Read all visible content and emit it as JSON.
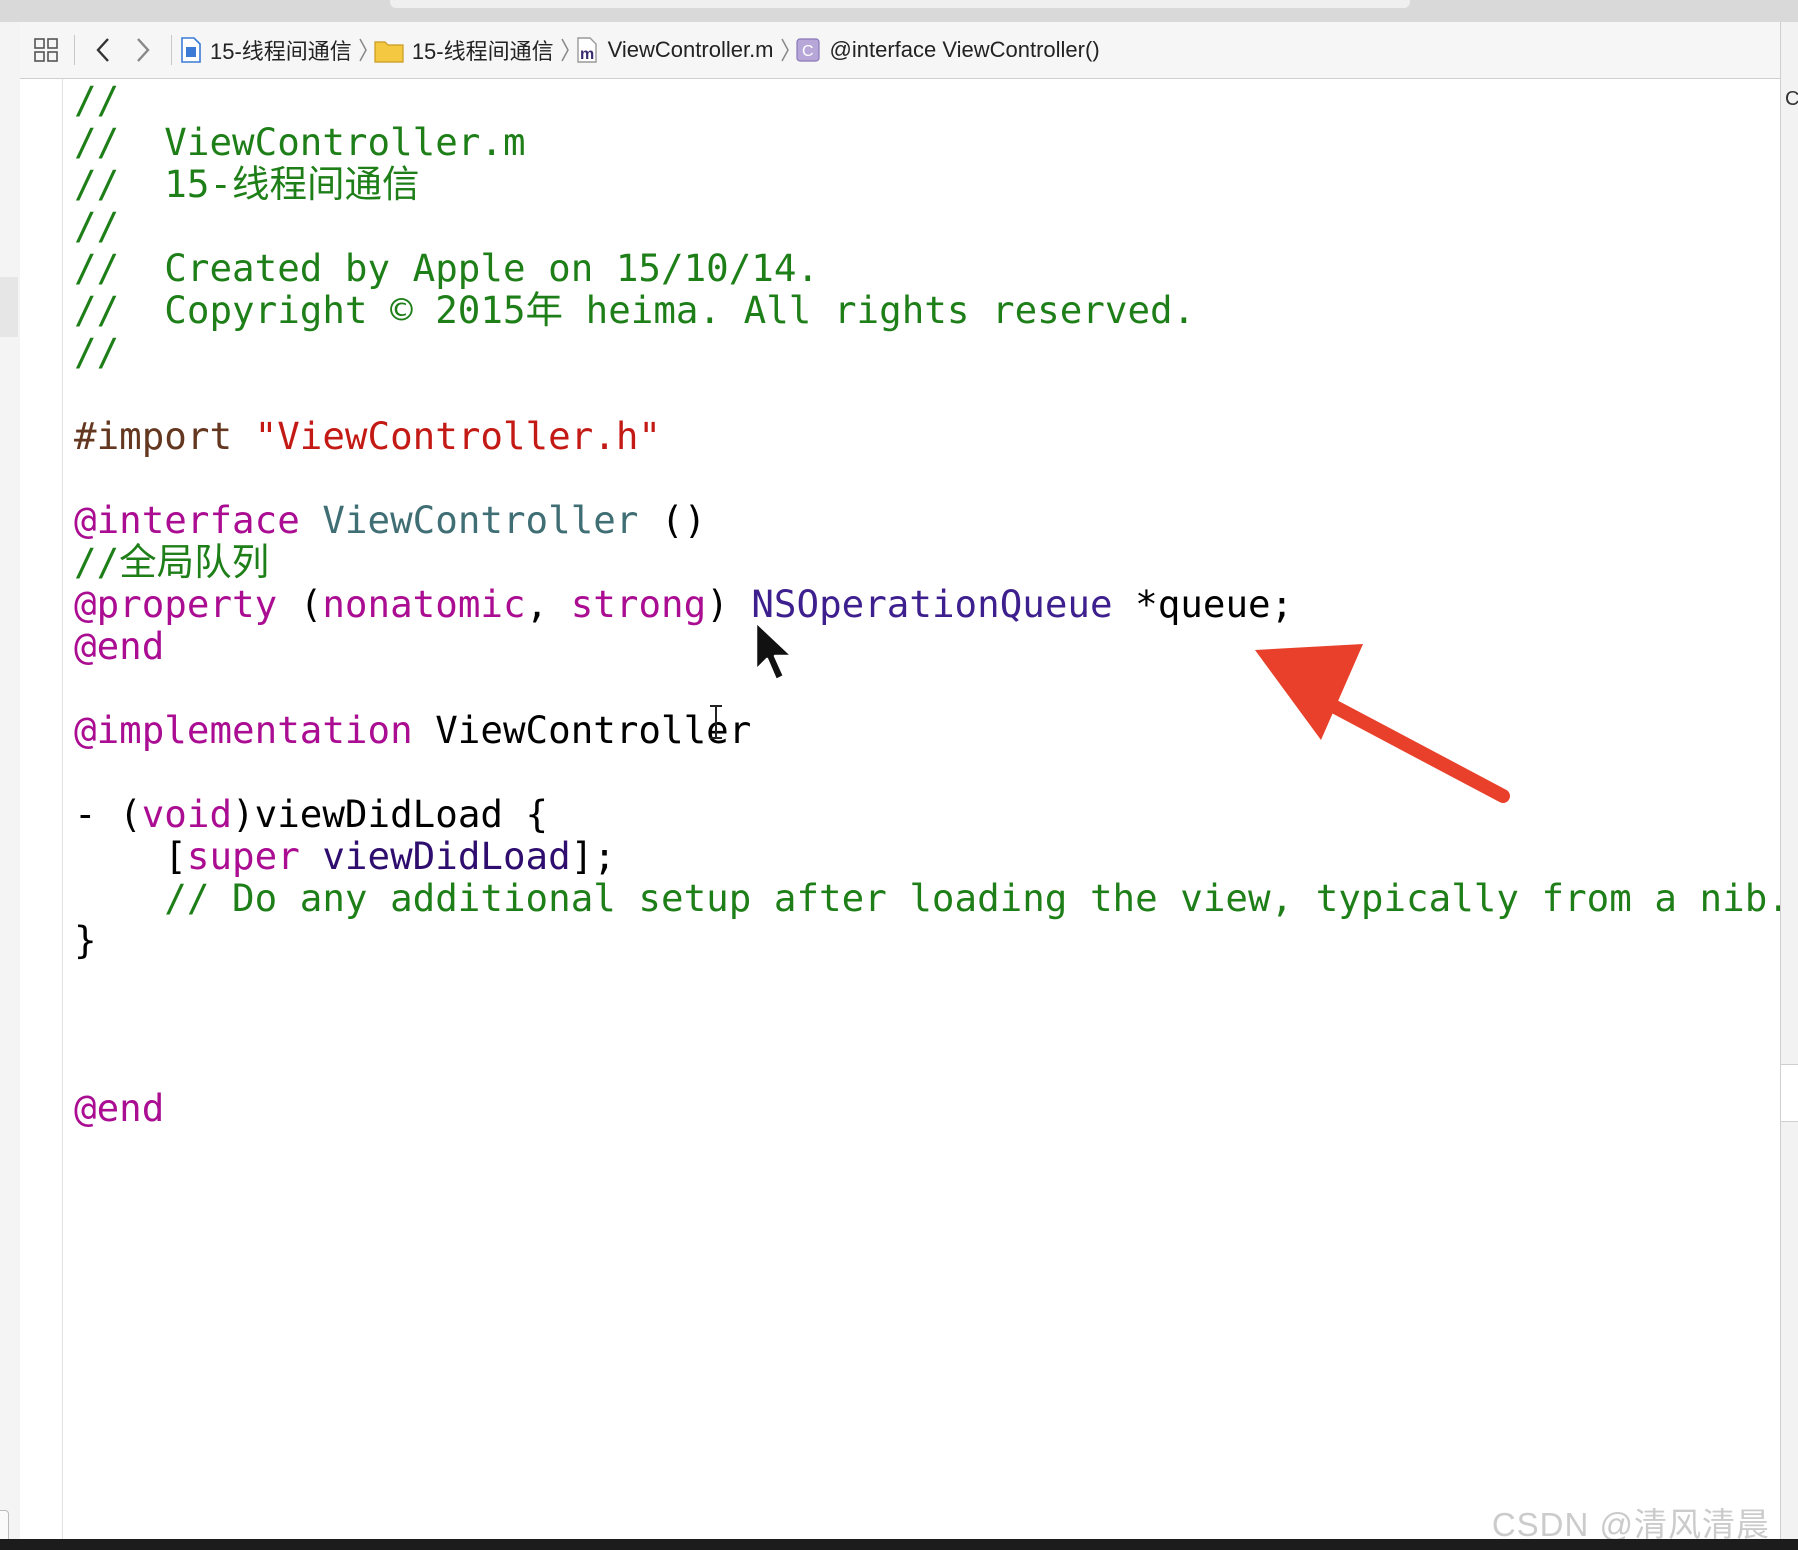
{
  "jumpbar": {
    "related_items_icon": "grid-icon",
    "back_icon": "chevron-left-icon",
    "forward_icon": "chevron-right-icon",
    "crumbs": [
      {
        "label": "15-线程间通信",
        "icon": "project-file-icon"
      },
      {
        "label": "15-线程间通信",
        "icon": "folder-icon"
      },
      {
        "label": "ViewController.m",
        "icon": "m-file-icon"
      },
      {
        "label": "@interface ViewController()",
        "icon": "class-icon"
      }
    ]
  },
  "code": {
    "lines": [
      "//",
      "//  ViewController.m",
      "//  15-线程间通信",
      "//",
      "//  Created by Apple on 15/10/14.",
      "//  Copyright © 2015年 heima. All rights reserved.",
      "//",
      "",
      "#import \"ViewController.h\"",
      "",
      "@interface ViewController ()",
      "//全局队列",
      "@property (nonatomic, strong) NSOperationQueue *queue;",
      "@end",
      "",
      "@implementation ViewController",
      "",
      "- (void)viewDidLoad {",
      "    [super viewDidLoad];",
      "    // Do any additional setup after loading the view, typically from a nib.",
      "}",
      "",
      "",
      "",
      "@end"
    ]
  },
  "colors": {
    "comment": "#1e7f19",
    "preprocessor": "#643820",
    "string": "#c41a16",
    "keyword": "#aa0d91",
    "type": "#3f6e74",
    "class": "#3e1f8e",
    "annotation_arrow": "#e8402a"
  },
  "watermark": "CSDN @清风清晨",
  "right_gutter_fragment": "C"
}
